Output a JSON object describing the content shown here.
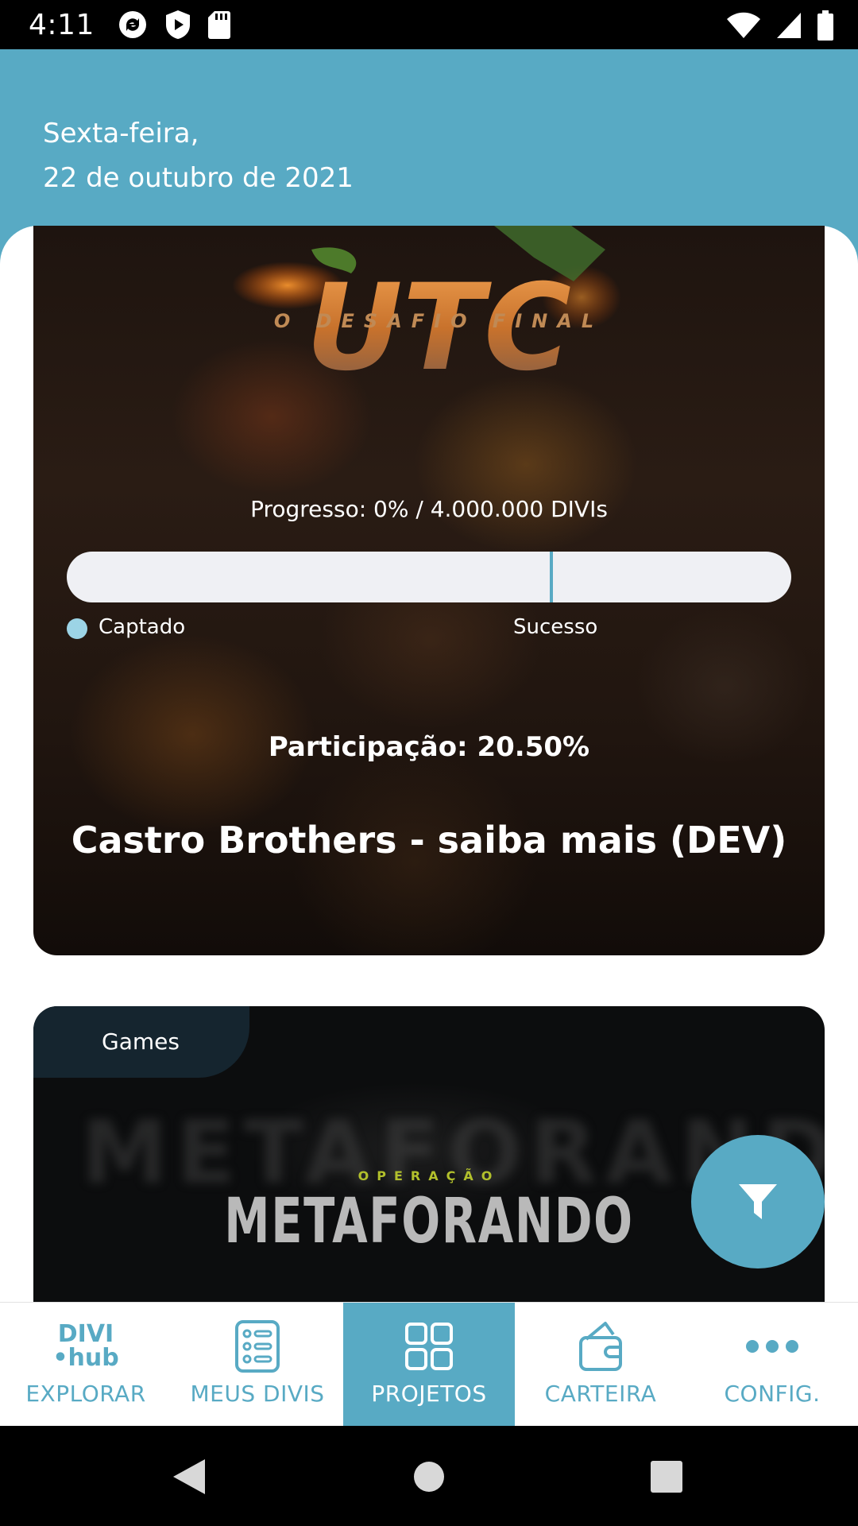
{
  "status_bar": {
    "time": "4:11",
    "left_icons": [
      "sync-icon",
      "play-shield-icon",
      "sd-card-icon"
    ],
    "right_icons": [
      "wifi-icon",
      "cell-signal-icon",
      "battery-icon"
    ]
  },
  "header": {
    "weekday": "Sexta-feira,",
    "date": "22 de outubro de 2021",
    "background_color": "#58aac4"
  },
  "projects": [
    {
      "logo_text": "UTC",
      "logo_subtitle": "O DESAFIO FINAL",
      "progress_label": "Progresso: 0% / 4.000.000 DIVIs",
      "progress": 0,
      "legend_captado": "Captado",
      "legend_sucesso": "Sucesso",
      "participation": "Participação: 20.50%",
      "title": "Castro Brothers - saiba mais (DEV)"
    },
    {
      "category": "Games",
      "logo_pretitle": "OPERAÇÃO",
      "logo_title": "METAFORANDO"
    }
  ],
  "fab": {
    "icon": "filter-icon"
  },
  "bottom_nav": [
    {
      "label": "EXPLORAR",
      "icon": "divi-hub-logo",
      "logo_line1": "DIVI",
      "logo_line2": "•hub",
      "active": false
    },
    {
      "label": "MEUS DIVIS",
      "icon": "list-icon",
      "active": false
    },
    {
      "label": "PROJETOS",
      "icon": "grid-icon",
      "active": true
    },
    {
      "label": "CARTEIRA",
      "icon": "wallet-icon",
      "active": false
    },
    {
      "label": "CONFIG.",
      "icon": "more-icon",
      "active": false
    }
  ],
  "system_nav": [
    "back-icon",
    "home-icon",
    "recents-icon"
  ]
}
